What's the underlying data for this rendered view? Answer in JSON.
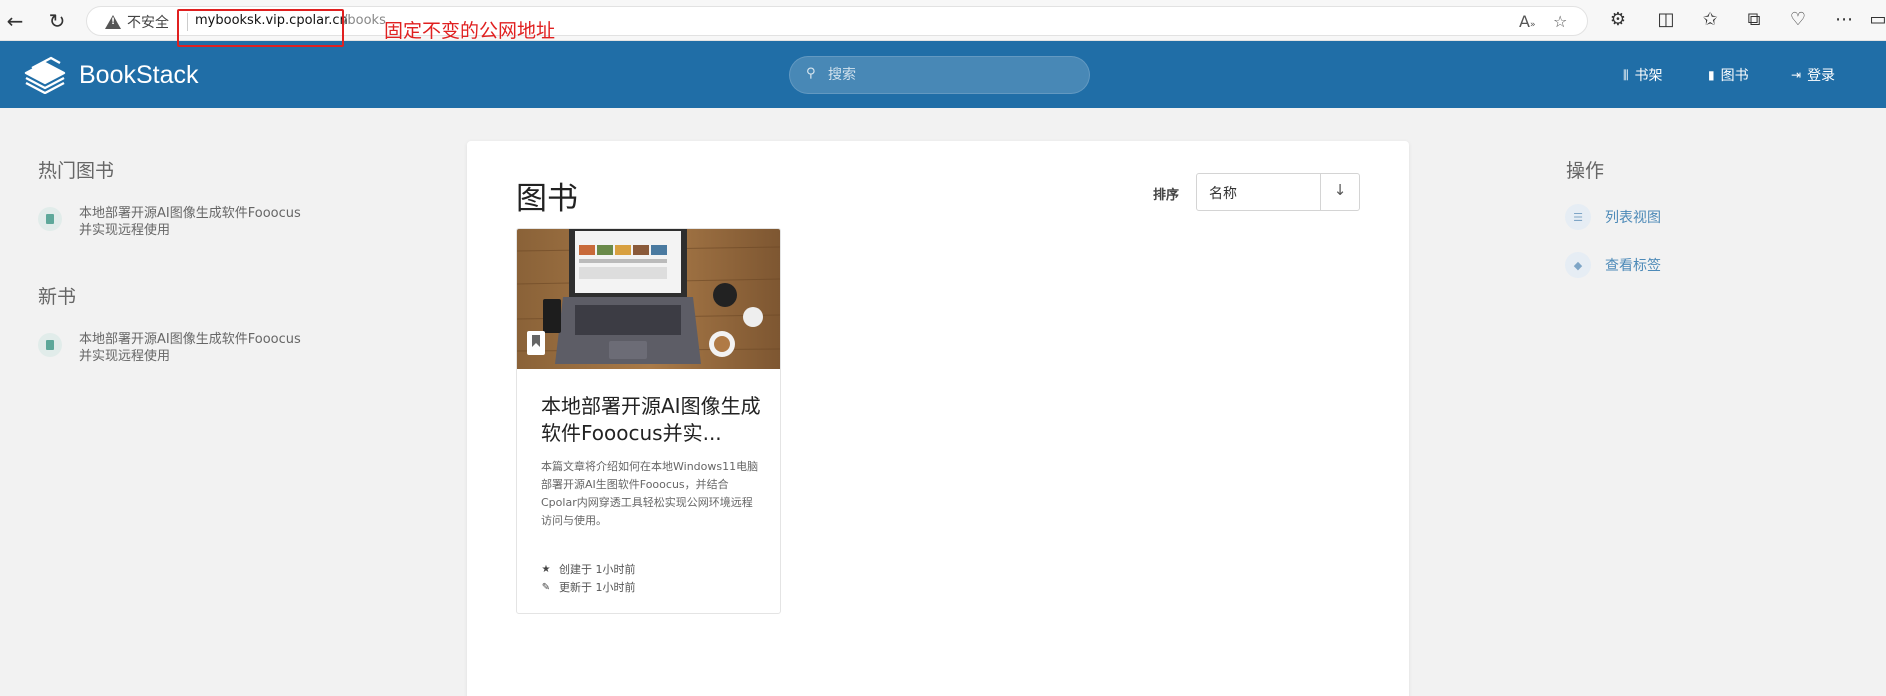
{
  "browser": {
    "insecure_label": "不安全",
    "url_host": "mybooksk.vip.cpolar.cn",
    "url_path": "/books",
    "annotation": "固定不变的公网地址"
  },
  "header": {
    "logo_text": "BookStack",
    "search_placeholder": "搜索",
    "nav": [
      {
        "icon": "shelves-icon",
        "label": "书架"
      },
      {
        "icon": "books-icon",
        "label": "图书"
      },
      {
        "icon": "login-icon",
        "label": "登录"
      }
    ]
  },
  "left_sidebar": {
    "popular_title": "热门图书",
    "popular_items": [
      {
        "line1": "本地部署开源AI图像生成软件Fooocus",
        "line2": "并实现远程使用"
      }
    ],
    "new_title": "新书",
    "new_items": [
      {
        "line1": "本地部署开源AI图像生成软件Fooocus",
        "line2": "并实现远程使用"
      }
    ]
  },
  "main": {
    "title": "图书",
    "sort_label": "排序",
    "sort_value": "名称",
    "sort_direction_symbol": "↓",
    "books": [
      {
        "title": "本地部署开源AI图像生成软件Fooocus并实...",
        "description_lines": [
          "本篇文章将介绍如何在本地Windows11电脑",
          "部署开源AI生图软件Fooocus，并结合",
          "Cpolar内网穿透工具轻松实现公网环境远程",
          "访问与使用。"
        ],
        "created": "创建于 1小时前",
        "updated": "更新于 1小时前"
      }
    ]
  },
  "right_sidebar": {
    "title": "操作",
    "actions": [
      {
        "icon": "list-view-icon",
        "label": "列表视图"
      },
      {
        "icon": "tag-icon",
        "label": "查看标签"
      }
    ]
  },
  "colors": {
    "header_bg": "#206ea7",
    "annotation_red": "#e02020",
    "link_blue": "#4d8ab8"
  }
}
